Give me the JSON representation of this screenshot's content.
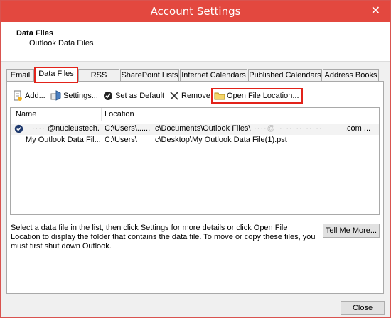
{
  "window": {
    "title": "Account Settings",
    "close_glyph": "✕"
  },
  "header": {
    "title": "Data Files",
    "subtitle": "Outlook Data Files"
  },
  "tabs": [
    {
      "label": "Email",
      "active": false
    },
    {
      "label": "Data Files",
      "active": true
    },
    {
      "label": "RSS Feeds",
      "active": false
    },
    {
      "label": "SharePoint Lists",
      "active": false
    },
    {
      "label": "Internet Calendars",
      "active": false
    },
    {
      "label": "Published Calendars",
      "active": false
    },
    {
      "label": "Address Books",
      "active": false
    }
  ],
  "toolbar": {
    "add_label": "Add...",
    "settings_label": "Settings...",
    "set_default_label": "Set as Default",
    "remove_label": "Remove",
    "open_location_label": "Open File Location..."
  },
  "list": {
    "columns": [
      "Name",
      "Location"
    ],
    "rows": [
      {
        "default": true,
        "name_prefix": "····",
        "name": "@nucleustech...",
        "loc_a": "C:\\Users\\......",
        "loc_b": "c\\Documents\\Outlook Files\\",
        "loc_c": "····@",
        "loc_d": "·············",
        "loc_e": ".com ..."
      },
      {
        "default": false,
        "name": "My Outlook Data Fil...",
        "loc_a": "C:\\Users\\",
        "loc_b": "c\\Desktop\\My Outlook Data File(1).pst"
      }
    ]
  },
  "description": "Select a data file in the list, then click Settings for more details or click Open File Location to display the folder that contains the data file. To move or copy these files, you must first shut down Outlook.",
  "buttons": {
    "tell_me_more": "Tell Me More...",
    "close": "Close"
  },
  "colors": {
    "titlebar": "#e3483f",
    "highlight": "#e2231a"
  }
}
